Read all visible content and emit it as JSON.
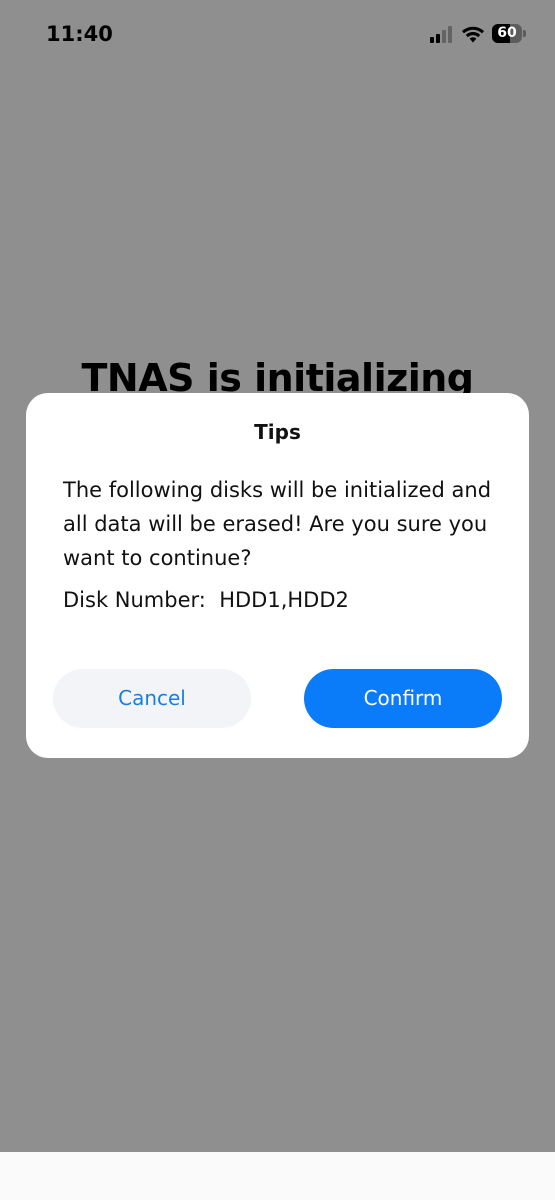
{
  "status_bar": {
    "time": "11:40",
    "battery_level": "60",
    "battery_fraction": 0.6
  },
  "background": {
    "title": "TNAS is initializing"
  },
  "dialog": {
    "title": "Tips",
    "message": "The following disks will be initialized and all data will be erased! Are you sure you want to continue?",
    "disk_label": "Disk Number:  HDD1,HDD2",
    "cancel_label": "Cancel",
    "confirm_label": "Confirm"
  },
  "colors": {
    "accent": "#0a7cf9",
    "cancel_text": "#1a7ee6",
    "cancel_bg": "#f2f4f8"
  },
  "icons": {
    "signal": "cellular-signal-icon",
    "wifi": "wifi-icon",
    "battery": "battery-icon"
  }
}
